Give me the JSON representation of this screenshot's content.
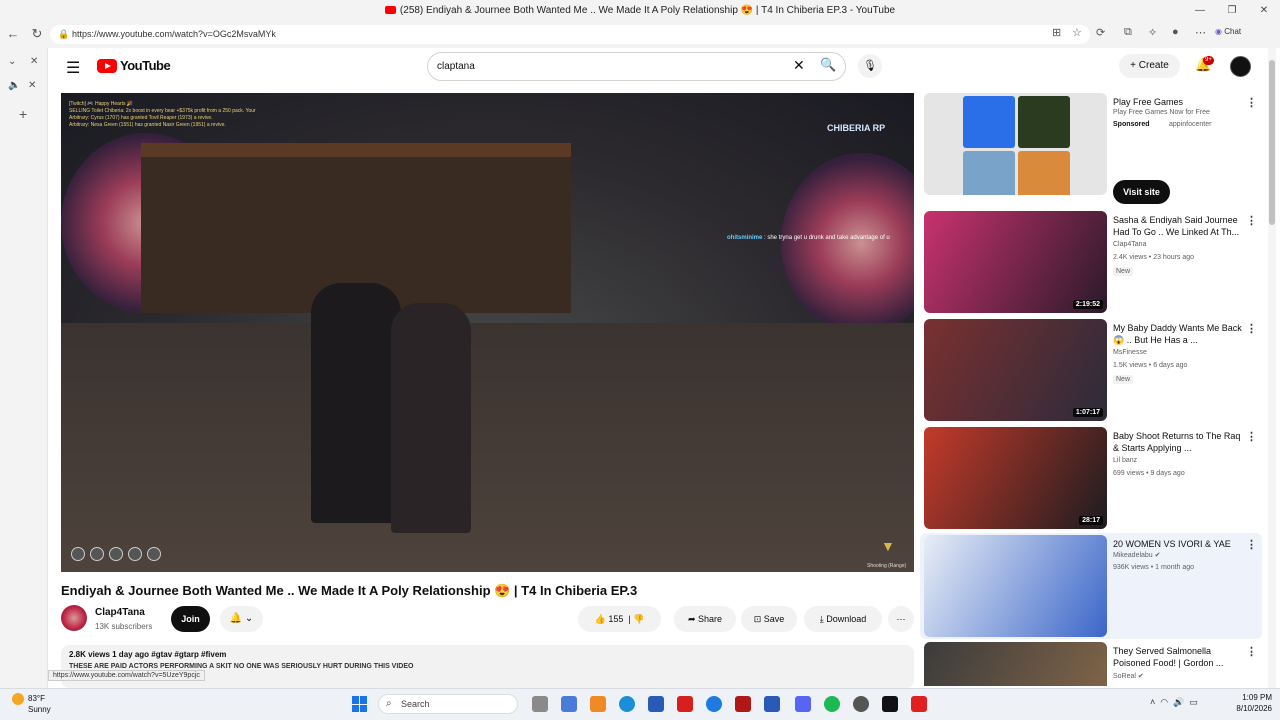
{
  "browser": {
    "tab_title": "(258) Endiyah & Journee Both Wanted Me .. We Made It A Poly Relationship 😍 | T4 In Chiberia EP.3 - YouTube",
    "url": "https://www.youtube.com/watch?v=OGc2MsvaMYk",
    "chat_label": "Chat",
    "status_url": "https://www.youtube.com/watch?v=5UzeY9pcjc"
  },
  "header": {
    "logo_text": "YouTube",
    "search_value": "claptana",
    "create_label": "Create",
    "notification_count": "9+"
  },
  "video": {
    "title": "Endiyah & Journee Both Wanted Me .. We Made It A Poly Relationship 😍 | T4 In Chiberia EP.3",
    "overlay_user": "ohitsminime",
    "overlay_msg": ": she tryna get u drunk and take advantage of u",
    "chat_lines": [
      "[Twitch] 🎮 Happy Hearts 🎉",
      "SELLING Toilet Chiberia: 2x boost in every bear +$375k profit from a 250 pack. Your",
      "Arbitrary: Cyrus (1707) has granted Tovil Reaper (1973) a revive.",
      "Arbitrary: Nesa Green (1551) has granted Nasir Green (1951) a revive."
    ],
    "game_logo": "CHIBERIA RP",
    "hud_text": "Shooting (Range)"
  },
  "channel": {
    "name": "Clap4Tana",
    "subscribers": "13K subscribers",
    "join_label": "Join"
  },
  "actions": {
    "likes": "155",
    "share": "Share",
    "save": "Save",
    "download": "Download"
  },
  "description": {
    "meta": "2.8K views  1 day ago  #gtav #gtarp #fivem",
    "line": "THESE ARE PAID ACTORS PERFORMING A SKIT NO ONE WAS SERIOUSLY HURT DURING THIS VIDEO"
  },
  "ad": {
    "title": "Play Free Games",
    "subtitle": "Play Free Games Now for Free",
    "sponsored": "Sponsored",
    "domain": "appinfocenter",
    "cta": "Visit site"
  },
  "recommendations": [
    {
      "title": "Sasha & Endiyah Said Journee Had To Go .. We Linked At Th...",
      "channel": "Clap4Tana",
      "meta": "2.4K views • 23 hours ago",
      "badge": "New",
      "duration": "2:19:52",
      "color1": "#c8326e",
      "color2": "#2a1a2a"
    },
    {
      "title": "My Baby Daddy Wants Me Back 😱 .. But He Has a ...",
      "channel": "MsFinesse",
      "meta": "1.5K views • 6 days ago",
      "badge": "New",
      "duration": "1:07:17",
      "color1": "#7a3030",
      "color2": "#2b2b3a"
    },
    {
      "title": "Baby Shoot Returns to The Raq & Starts Applying ...",
      "channel": "Lil banz",
      "meta": "699 views • 9 days ago",
      "badge": "",
      "duration": "28:17",
      "color1": "#c43a2a",
      "color2": "#1c1c20"
    },
    {
      "title": "20 WOMEN VS IVORI & YAE",
      "channel": "Mikeadelabu",
      "meta": "936K views • 1 month ago",
      "badge": "",
      "duration": "",
      "color1": "#e9eef6",
      "color2": "#3b66c9"
    },
    {
      "title": "They Served Salmonella Poisoned Food! | Gordon ...",
      "channel": "SoReal",
      "meta": "",
      "badge": "",
      "duration": "",
      "color1": "#3b3b3b",
      "color2": "#8a6a4a"
    }
  ],
  "taskbar": {
    "temp": "83°F",
    "condition": "Sunny",
    "search_label": "Search",
    "time": "1:09 PM",
    "date": "8/10/2026"
  },
  "colors": {
    "brand_red": "#ff0000",
    "accent_blue": "#065fd4"
  }
}
